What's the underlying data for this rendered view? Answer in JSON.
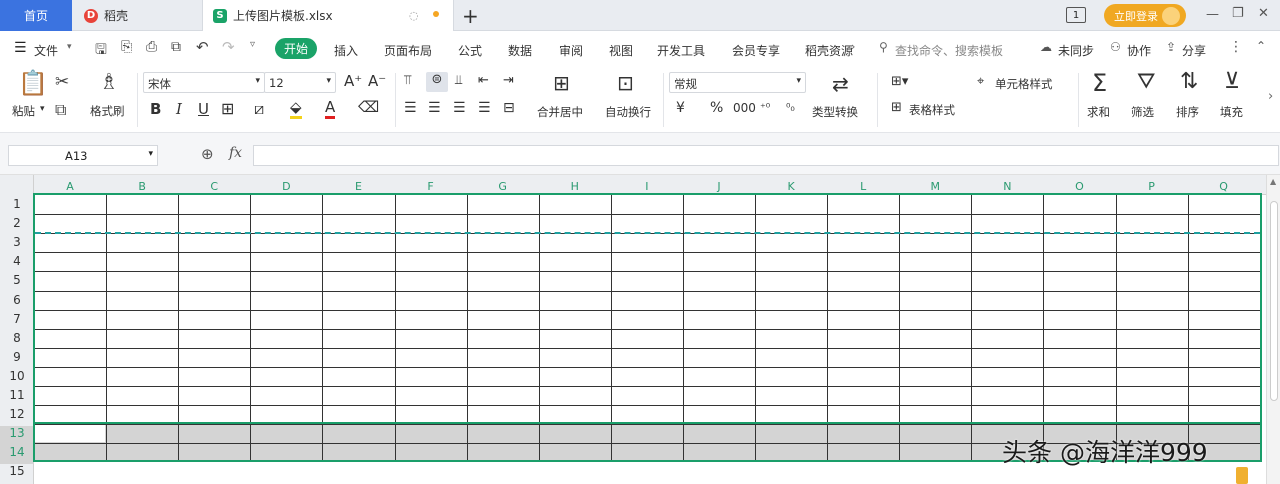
{
  "tabbar": {
    "home_tab": "首页",
    "doc_tab": "稻壳",
    "file_tab": "上传图片模板.xlsx",
    "new_tab": "+",
    "login_button": "立即登录",
    "window_buttons": [
      "—",
      "❐",
      "✕"
    ]
  },
  "menu": {
    "file": "文件",
    "tabs": [
      "开始",
      "插入",
      "页面布局",
      "公式",
      "数据",
      "审阅",
      "视图",
      "开发工具",
      "会员专享",
      "稻壳资源"
    ],
    "search_placeholder": "查找命令、搜索模板",
    "sync": "未同步",
    "collab": "协作",
    "share": "分享"
  },
  "ribbon": {
    "paste": "粘贴",
    "format_painter": "格式刷",
    "font_name": "宋体",
    "font_size": "12",
    "merge_center": "合并居中",
    "auto_wrap": "自动换行",
    "number_format": "常规",
    "type_convert": "类型转换",
    "conditional_format": "条件格式",
    "cell_style": "单元格样式",
    "table_style": "表格样式",
    "sum": "求和",
    "filter": "筛选",
    "sort": "排序",
    "fill": "填充"
  },
  "formula_bar": {
    "cell_ref": "A13",
    "fx": "fx",
    "content": ""
  },
  "sheet": {
    "columns": [
      "A",
      "B",
      "C",
      "D",
      "E",
      "F",
      "G",
      "H",
      "I",
      "J",
      "K",
      "L",
      "M",
      "N",
      "O",
      "P",
      "Q"
    ],
    "rows": [
      "1",
      "2",
      "3",
      "4",
      "5",
      "6",
      "7",
      "8",
      "9",
      "10",
      "11",
      "12",
      "13",
      "14",
      "15"
    ],
    "selected_rows": [
      "13",
      "14"
    ],
    "active_cell": "A13"
  },
  "watermark": "头条 @海洋洋999"
}
